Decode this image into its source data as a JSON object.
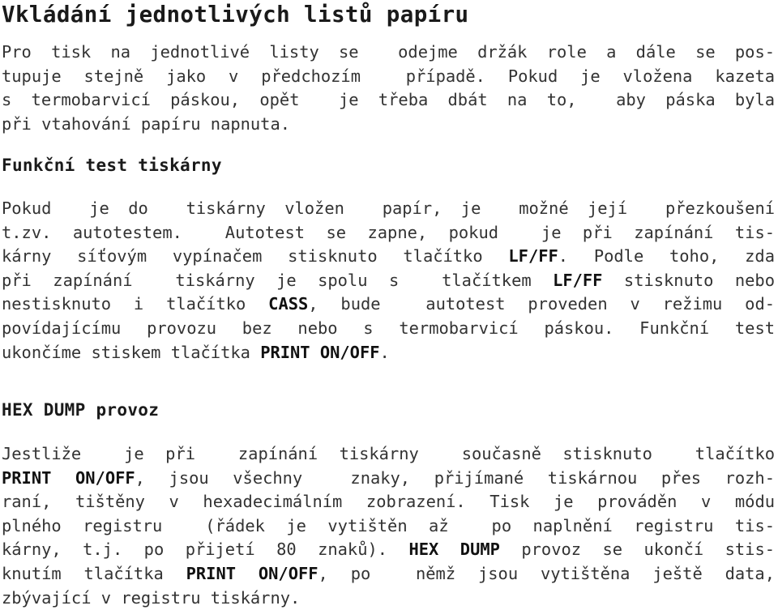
{
  "document": {
    "language": "cs",
    "title": "Vkládání jednotlivých listů papíru",
    "text_color": "#333333",
    "heading_color": "#1a1a1a",
    "background_color": "#ffffff"
  },
  "intro_paragraph": {
    "lines": [
      "Pro tisk na jednotlivé listy se  odejme držák role a dále se pos-",
      "tupuje stejně jako v předchozím  případě. Pokud je vložena kazeta",
      "s termobarvicí páskou, opět  je třeba dbát na to,  aby páska byla",
      "při vtahování papíru napnuta."
    ]
  },
  "section_function_test": {
    "heading": "Funkční test tiskárny",
    "lines": [
      [
        {
          "t": "Pokud  je do  tiskárny vložen  papír, je  možné její  přezkoušení",
          "b": false
        }
      ],
      [
        {
          "t": "t.zv. autotestem.  Autotest se zapne, pokud  je při zapínání tis-",
          "b": false
        }
      ],
      [
        {
          "t": "kárny síťovým vypínačem stisknuto tlačítko ",
          "b": false
        },
        {
          "t": "LF/FF",
          "b": true
        },
        {
          "t": ". Podle toho, zda",
          "b": false
        }
      ],
      [
        {
          "t": "při zapínání  tiskárny je spolu s  tlačítkem ",
          "b": false
        },
        {
          "t": "LF/FF",
          "b": true
        },
        {
          "t": " stisknuto nebo",
          "b": false
        }
      ],
      [
        {
          "t": "nestisknuto i tlačítko ",
          "b": false
        },
        {
          "t": "CASS",
          "b": true
        },
        {
          "t": ", bude  autotest proveden v režimu od-",
          "b": false
        }
      ],
      [
        {
          "t": "povídajícímu provozu bez nebo s termobarvicí páskou. Funkční test",
          "b": false
        }
      ],
      [
        {
          "t": "ukončíme stiskem tlačítka ",
          "b": false
        },
        {
          "t": "PRINT ON/OFF",
          "b": true
        },
        {
          "t": ".",
          "b": false
        }
      ]
    ]
  },
  "section_hex_dump": {
    "heading": "HEX DUMP provoz",
    "lines": [
      [
        {
          "t": "Jestliže  je při  zapínání tiskárny  současně stisknuto  tlačítko",
          "b": false
        }
      ],
      [
        {
          "t": "PRINT ON/OFF",
          "b": true
        },
        {
          "t": ", jsou všechny  znaky, přijímané tiskárnou přes rozh-",
          "b": false
        }
      ],
      [
        {
          "t": "raní, tištěny v hexadecimálním zobrazení. Tisk je prováděn v módu",
          "b": false
        }
      ],
      [
        {
          "t": "plného registru  (řádek je vytištěn až  po naplnění registru tis-",
          "b": false
        }
      ],
      [
        {
          "t": "kárny, t.j. po přijetí 80 znaků). ",
          "b": false
        },
        {
          "t": "HEX DUMP",
          "b": true
        },
        {
          "t": " provoz se ukončí stis-",
          "b": false
        }
      ],
      [
        {
          "t": "knutím tlačítka ",
          "b": false
        },
        {
          "t": "PRINT ON/OFF",
          "b": true
        },
        {
          "t": ", po  němž jsou vytištěna ještě data,",
          "b": false
        }
      ],
      [
        {
          "t": "zbývající v registru tiskárny.",
          "b": false
        }
      ]
    ]
  }
}
